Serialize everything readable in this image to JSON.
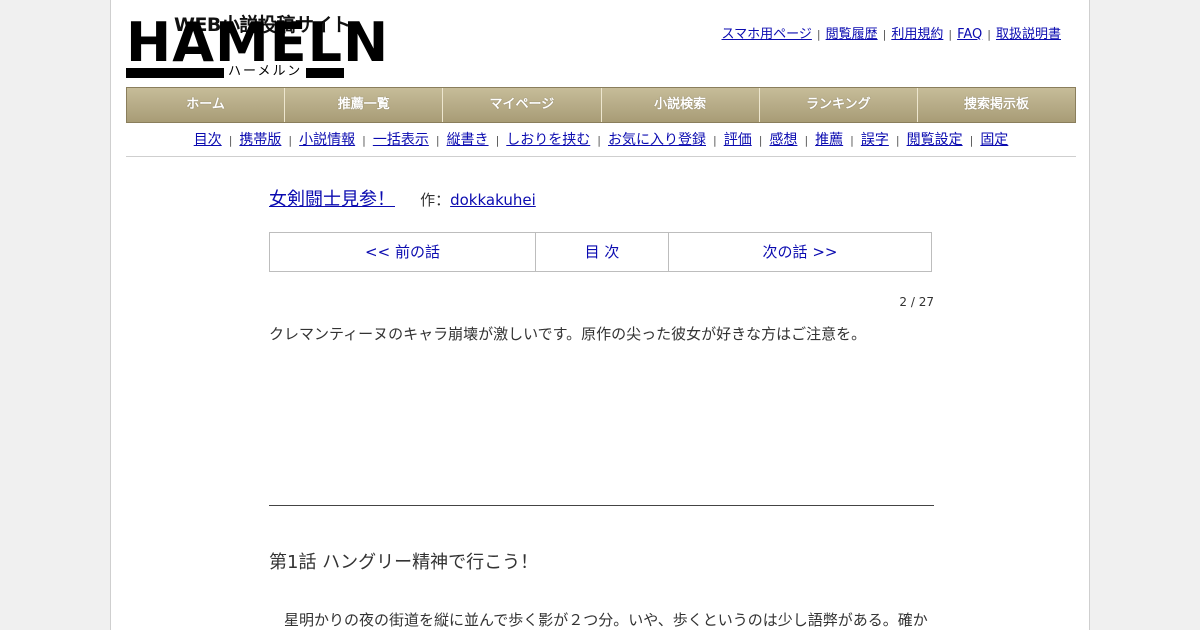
{
  "logo": {
    "tagline": "WEB小説投稿サイト",
    "name": "HAMELN",
    "kana": "ハーメルン"
  },
  "top_links": [
    "スマホ用ページ",
    "閲覧履歴",
    "利用規約",
    "FAQ",
    "取扱説明書"
  ],
  "main_nav": [
    "ホーム",
    "推薦一覧",
    "マイページ",
    "小説検索",
    "ランキング",
    "捜索掲示板"
  ],
  "sub_nav": [
    "目次",
    "携帯版",
    "小説情報",
    "一括表示",
    "縦書き",
    "しおりを挟む",
    "お気に入り登録",
    "評価",
    "感想",
    "推薦",
    "誤字",
    "閲覧設定",
    "固定"
  ],
  "novel": {
    "title": "女剣闘士見参！",
    "author_label": "作：",
    "author": "dokkakuhei"
  },
  "chapter_nav": {
    "prev": "<< 前の話",
    "toc": "目 次",
    "next": "次の話 >>"
  },
  "counter": "2 / 27",
  "foreword": "クレマンティーヌのキャラ崩壊が激しいです。原作の尖った彼女が好きな方はご注意を。",
  "chapter_title": "第1話 ハングリー精神で行こう！",
  "body_text": "　星明かりの夜の街道を縦に並んで歩く影が２つ分。いや、歩くというのは少し語弊がある。確か",
  "colors": {
    "link": "#0b0bb0",
    "nav_bg": "#b3a884",
    "page_bg": "#f0f0f0"
  }
}
